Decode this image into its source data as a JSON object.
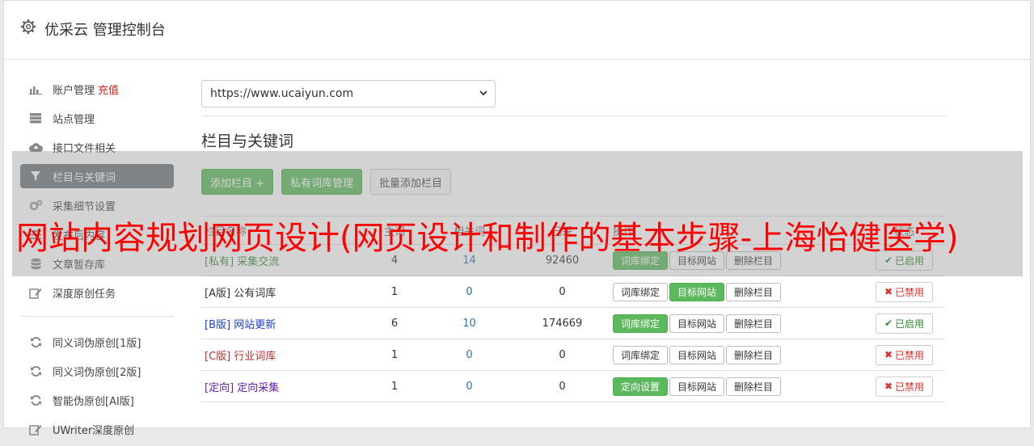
{
  "app": {
    "title": "优采云 管理控制台",
    "icon": "gear-icon"
  },
  "sidebar": {
    "items": [
      {
        "label": "账户管理",
        "extra": "充值",
        "icon": "bar-chart-icon"
      },
      {
        "label": "站点管理",
        "icon": "server-icon"
      },
      {
        "label": "接口文件相关",
        "icon": "cloud-upload-icon"
      },
      {
        "label": "栏目与关键词",
        "icon": "filter-icon",
        "active": true
      },
      {
        "label": "采集细节设置",
        "icon": "cogs-icon"
      },
      {
        "label": "发布后内容",
        "icon": "list-icon"
      },
      {
        "label": "文章暂存库",
        "icon": "database-icon"
      },
      {
        "label": "深度原创任务",
        "icon": "edit-icon"
      }
    ],
    "items2": [
      {
        "label": "同义词伪原创[1版]",
        "icon": "refresh-icon"
      },
      {
        "label": "同义词伪原创[2版]",
        "icon": "refresh-icon"
      },
      {
        "label": "智能伪原创[AI版]",
        "icon": "refresh-icon"
      },
      {
        "label": "UWriter深度原创",
        "icon": "edit-icon"
      }
    ]
  },
  "main": {
    "site_select": {
      "value": "https://www.ucaiyun.com"
    },
    "section_title": "栏目与关键词",
    "buttons": {
      "add": "添加栏目 +",
      "private_lib": "私有词库管理",
      "batch_add": "批量添加栏目"
    },
    "table": {
      "headers": [
        "栏目名称",
        "主词",
        "相关词",
        "已采",
        "操作",
        "状态"
      ],
      "rows": [
        {
          "tag": "[私有]",
          "name": "采集交流",
          "n1": "4",
          "n2": "14",
          "n3": "92460",
          "tag_color": "#3c8a3c",
          "ops": [
            "词库绑定",
            "目标网站",
            "删除栏目"
          ],
          "op_styles": [
            "green",
            "light",
            "light"
          ],
          "status": "已启用",
          "status_on": true
        },
        {
          "tag": "[A版]",
          "name": "公有词库",
          "n1": "1",
          "n2": "0",
          "n3": "0",
          "tag_color": "#333333",
          "ops": [
            "词库绑定",
            "目标网站",
            "删除栏目"
          ],
          "op_styles": [
            "light",
            "green",
            "light"
          ],
          "status": "已禁用",
          "status_on": false
        },
        {
          "tag": "[B版]",
          "name": "网站更新",
          "n1": "6",
          "n2": "10",
          "n3": "174669",
          "tag_color": "#1a3fd1",
          "ops": [
            "词库绑定",
            "目标网站",
            "删除栏目"
          ],
          "op_styles": [
            "green",
            "light",
            "light"
          ],
          "status": "已启用",
          "status_on": true
        },
        {
          "tag": "[C版]",
          "name": "行业词库",
          "n1": "1",
          "n2": "0",
          "n3": "0",
          "tag_color": "#b8302d",
          "ops": [
            "词库绑定",
            "目标网站",
            "删除栏目"
          ],
          "op_styles": [
            "light",
            "light",
            "light"
          ],
          "status": "已禁用",
          "status_on": false
        },
        {
          "tag": "[定向]",
          "name": "定向采集",
          "n1": "1",
          "n2": "0",
          "n3": "0",
          "tag_color": "#6a1fb0",
          "ops": [
            "定向设置",
            "目标网站",
            "删除栏目"
          ],
          "op_styles": [
            "green",
            "light",
            "light"
          ],
          "status": "已禁用",
          "status_on": false
        }
      ]
    }
  },
  "overlay_text": "网站内容规划网页设计(网页设计和制作的基本步骤-上海怡健医学)",
  "colors": {
    "accent_green": "#5cb85c",
    "active_nav": "#6c757d",
    "banner_red": "#ff0000",
    "enabled_green": "#2e8b2e",
    "disabled_red": "#d9302c"
  }
}
